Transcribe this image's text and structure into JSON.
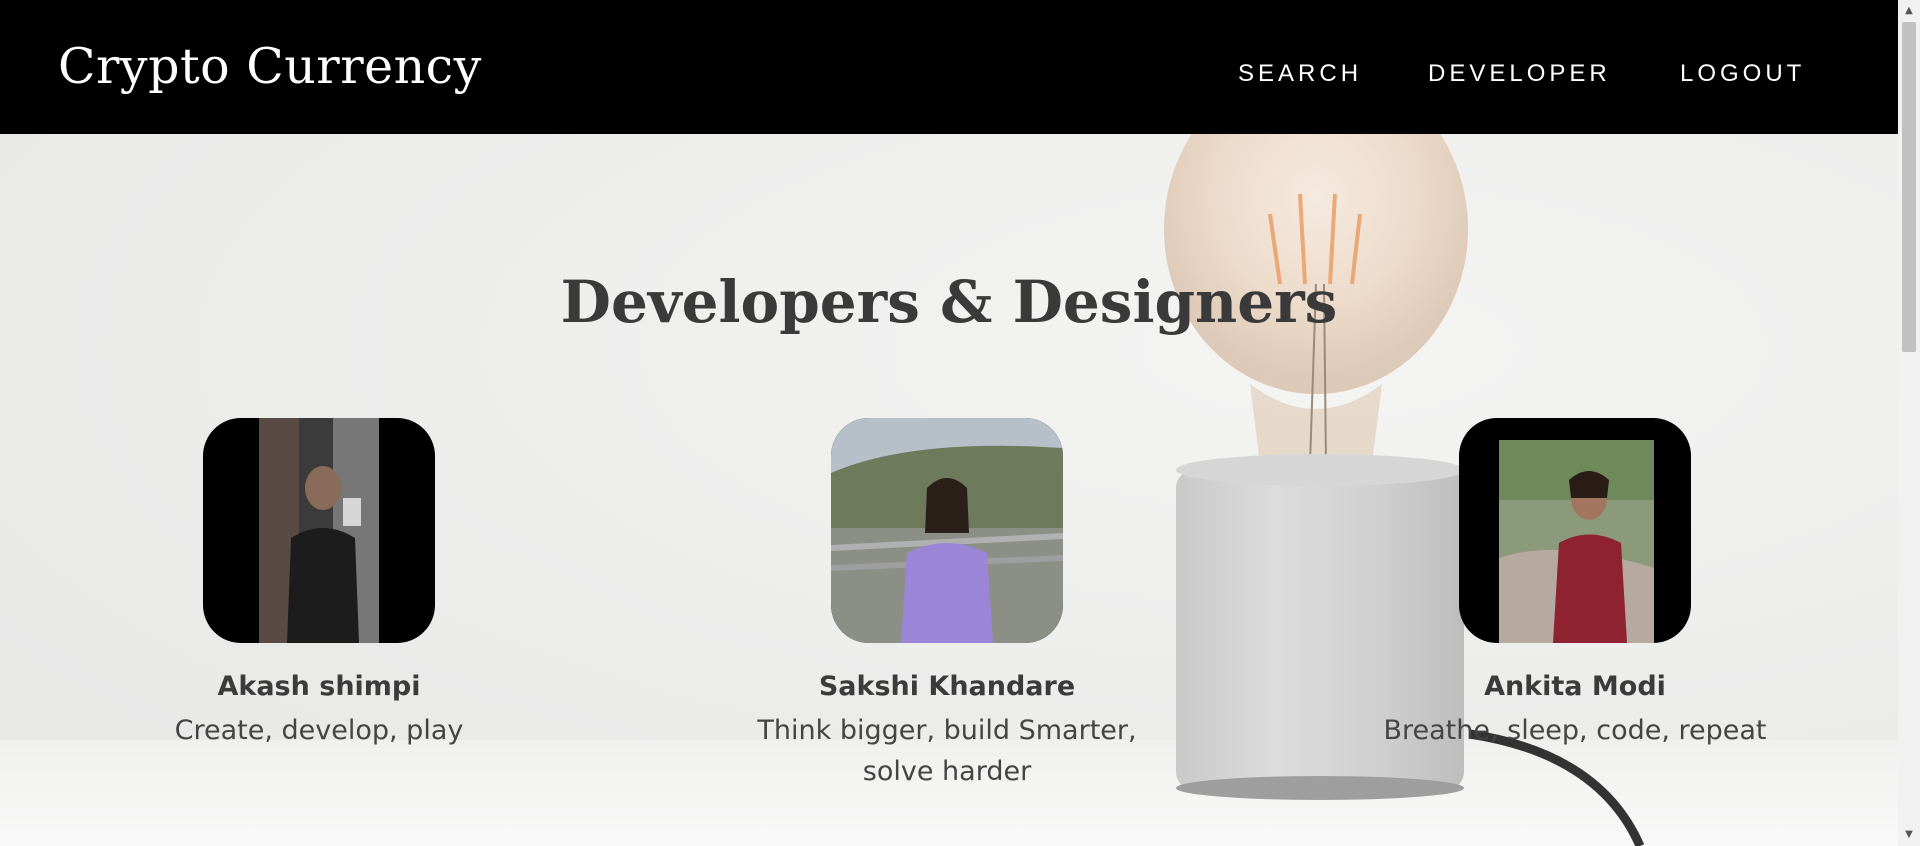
{
  "header": {
    "brand": "Crypto Currency",
    "nav": [
      "SEARCH",
      "DEVELOPER",
      "LOGOUT"
    ]
  },
  "main": {
    "title": "Developers & Designers",
    "members": [
      {
        "name": "Akash shimpi",
        "tagline": "Create, develop, play"
      },
      {
        "name": "Sakshi Khandare",
        "tagline": "Think bigger, build Smarter, solve harder"
      },
      {
        "name": "Ankita Modi",
        "tagline": "Breathe, sleep, code, repeat"
      }
    ]
  },
  "colors": {
    "navbar": "#000000",
    "heading": "#3a3a3a",
    "background": "#ececeb"
  },
  "icons": {
    "scroll_up": "triangle-up",
    "scroll_down": "triangle-down"
  }
}
